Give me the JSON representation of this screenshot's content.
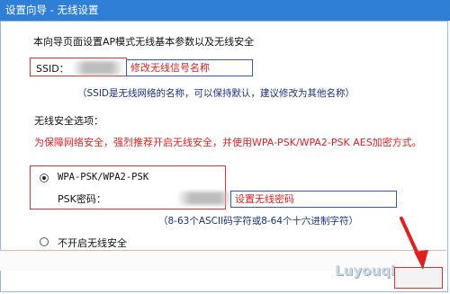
{
  "window": {
    "title": "设置向导 - 无线设置"
  },
  "intro": "本向导页面设置AP模式无线基本参数以及无线安全",
  "ssid": {
    "label": "SSID：",
    "annotation": "修改无线信号名称",
    "hint": "（SSID是无线网络的名称，可以保持默认，建议修改为其他名称）"
  },
  "security": {
    "heading": "无线安全选项：",
    "warning": "为保障网络安全，强烈推荐开启无线安全，并使用WPA-PSK/WPA2-PSK AES加密方式。",
    "wpa_option": {
      "label": "WPA-PSK/WPA2-PSK",
      "selected": true
    },
    "psk": {
      "label": "PSK密码：",
      "annotation": "设置无线密码",
      "hint": "（8-63个ASCII码字符或8-64个十六进制字符）"
    },
    "none_option": {
      "label": "不开启无线安全",
      "selected": false
    }
  },
  "watermark": "Luyouqi.com",
  "colors": {
    "titlebar": "#2f7fd6",
    "annotation_red": "#e02020",
    "hint_blue": "#1a2f80",
    "arrow": "#e02020"
  },
  "icons": {
    "radio_selected": "radio-selected-icon",
    "radio_unselected": "radio-unselected-icon",
    "arrow": "red-arrow-icon"
  }
}
